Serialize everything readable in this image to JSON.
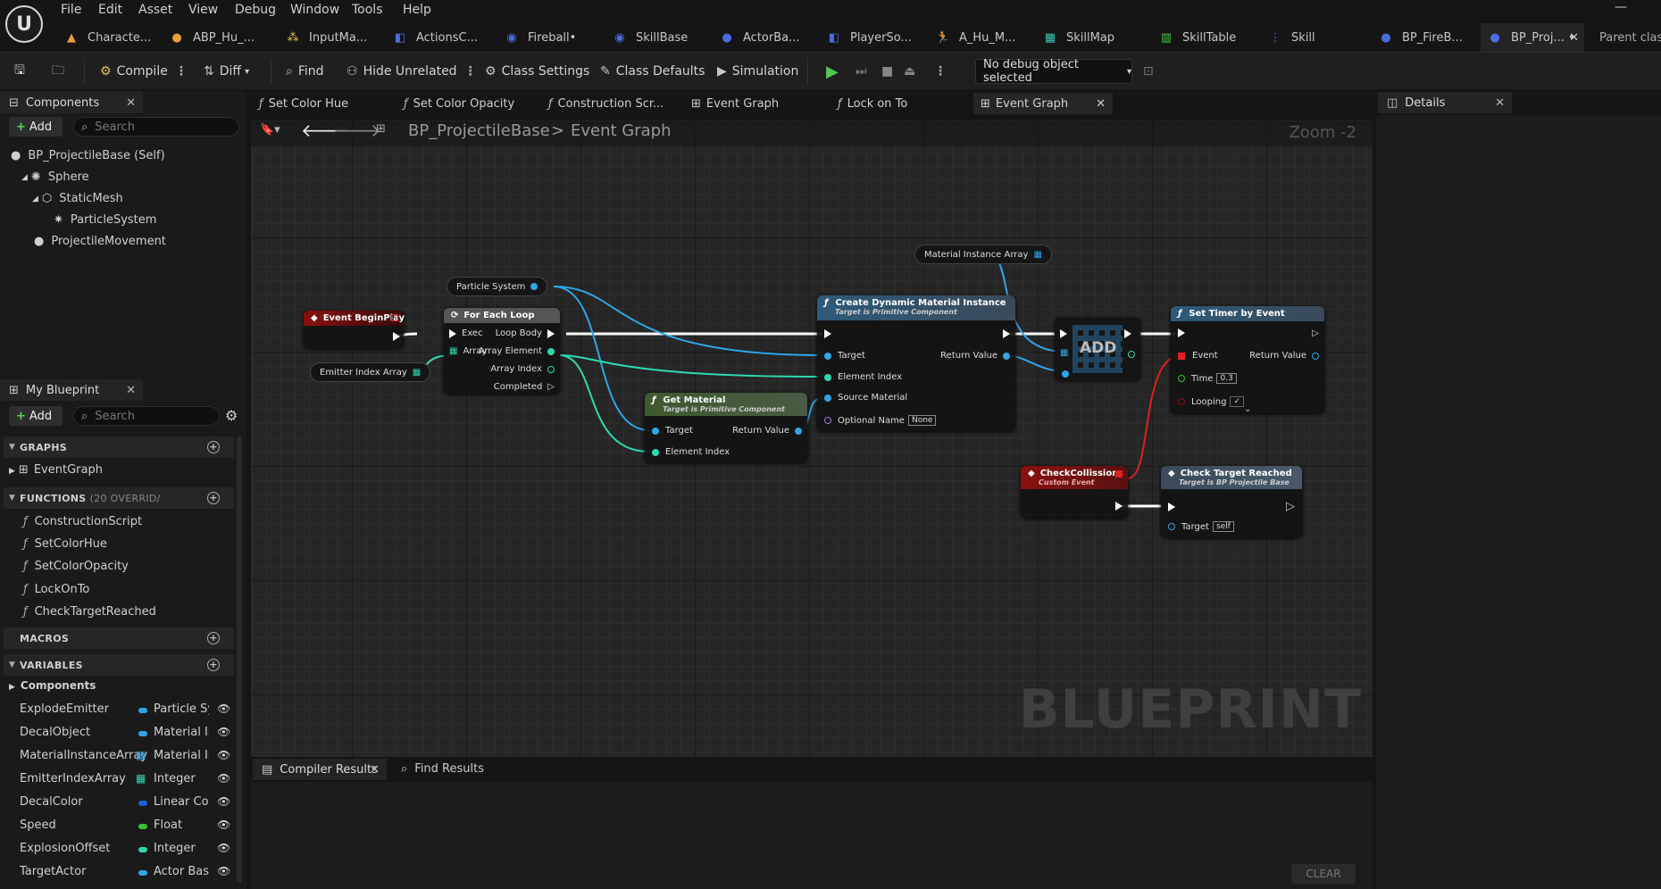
{
  "menu": [
    "File",
    "Edit",
    "Asset",
    "View",
    "Debug",
    "Window",
    "Tools",
    "Help"
  ],
  "asset_tabs": [
    {
      "label": "Characte...",
      "icon": "person-icon"
    },
    {
      "label": "ABP_Hu_...",
      "icon": "person-icon"
    },
    {
      "label": "InputMa...",
      "icon": "input-icon"
    },
    {
      "label": "ActionsC...",
      "icon": "blueprint-icon"
    },
    {
      "label": "Fireball•",
      "icon": "blueprint-icon"
    },
    {
      "label": "SkillBase",
      "icon": "blueprint-icon"
    },
    {
      "label": "ActorBa...",
      "icon": "person-icon"
    },
    {
      "label": "PlayerSo...",
      "icon": "blueprint-icon"
    },
    {
      "label": "A_Hu_M...",
      "icon": "animation-icon"
    },
    {
      "label": "SkillMap",
      "icon": "map-icon"
    },
    {
      "label": "SkillTable",
      "icon": "table-icon"
    },
    {
      "label": "Skill",
      "icon": "struct-icon"
    },
    {
      "label": "BP_FireB...",
      "icon": "person-icon"
    },
    {
      "label": "BP_Proj... •",
      "icon": "person-icon"
    }
  ],
  "parent_class": "Parent class",
  "toolbar": {
    "compile": "Compile",
    "diff": "Diff",
    "find": "Find",
    "hide_unrelated": "Hide Unrelated",
    "class_settings": "Class Settings",
    "class_defaults": "Class Defaults",
    "simulation": "Simulation",
    "debug_object": "No debug object selected"
  },
  "graph_tabs": [
    {
      "label": "Set Color Hue",
      "kind": "function"
    },
    {
      "label": "Set Color Opacity",
      "kind": "function"
    },
    {
      "label": "Construction Scr...",
      "kind": "function"
    },
    {
      "label": "Event Graph",
      "kind": "graph"
    },
    {
      "label": "Lock on To",
      "kind": "function"
    },
    {
      "label": "Event Graph",
      "kind": "graph"
    }
  ],
  "components_panel": {
    "title": "Components",
    "add": "Add",
    "search_placeholder": "Search",
    "items": [
      "BP_ProjectileBase (Self)",
      "Sphere",
      "StaticMesh",
      "ParticleSystem",
      "ProjectileMovement"
    ]
  },
  "my_blueprint": {
    "title": "My Blueprint",
    "add": "Add",
    "search_placeholder": "Search",
    "graphs_header": "GRAPHS",
    "graphs": [
      "EventGraph"
    ],
    "functions_header": "FUNCTIONS",
    "functions_overrides": "(20 OVERRID/",
    "functions": [
      "ConstructionScript",
      "SetColorHue",
      "SetColorOpacity",
      "LockOnTo",
      "CheckTargetReached"
    ],
    "macros_header": "MACROS",
    "variables_header": "VARIABLES",
    "components_group": "Components",
    "variables": [
      {
        "name": "ExplodeEmitter",
        "type": "Particle Sy",
        "color": "#2fa6e8",
        "kind": "single"
      },
      {
        "name": "DecalObject",
        "type": "Material In",
        "color": "#2fa6e8",
        "kind": "single"
      },
      {
        "name": "MaterialInstanceArray",
        "type": "Material In",
        "color": "#2fa6e8",
        "kind": "array"
      },
      {
        "name": "EmitterIndexArray",
        "type": "Integer",
        "color": "#2fd9b0",
        "kind": "array"
      },
      {
        "name": "DecalColor",
        "type": "Linear Colo",
        "color": "#1a5fd6",
        "kind": "single"
      },
      {
        "name": "Speed",
        "type": "Float",
        "color": "#35c435",
        "kind": "single"
      },
      {
        "name": "ExplosionOffset",
        "type": "Integer",
        "color": "#2fd9b0",
        "kind": "single"
      },
      {
        "name": "TargetActor",
        "type": "Actor Base",
        "color": "#2fa6e8",
        "kind": "single"
      }
    ]
  },
  "breadcrumb": {
    "root": "BP_ProjectileBase",
    "sep": ">",
    "leaf": "Event Graph"
  },
  "zoom": "Zoom -2",
  "watermark": "BLUEPRINT",
  "nodes": {
    "event_begin_play": {
      "title": "Event BeginPlay"
    },
    "emitter_index_array": {
      "label": "Emitter Index Array"
    },
    "particle_system": {
      "label": "Particle System"
    },
    "for_each": {
      "title": "For Each Loop",
      "exec": "Exec",
      "array": "Array",
      "loop_body": "Loop Body",
      "array_element": "Array Element",
      "array_index": "Array Index",
      "completed": "Completed"
    },
    "material_instance_array": {
      "label": "Material Instance Array"
    },
    "create_dmi": {
      "title": "Create Dynamic Material Instance",
      "subtitle": "Target is Primitive Component",
      "target": "Target",
      "element_index": "Element Index",
      "source_material": "Source Material",
      "optional_name": "Optional Name",
      "optional_name_value": "None",
      "return_value": "Return Value"
    },
    "get_material": {
      "title": "Get Material",
      "subtitle": "Target is Primitive Component",
      "target": "Target",
      "element_index": "Element Index",
      "return_value": "Return Value"
    },
    "add": {
      "label": "ADD"
    },
    "set_timer": {
      "title": "Set Timer by Event",
      "event": "Event",
      "time": "Time",
      "time_value": "0.3",
      "looping": "Looping",
      "return_value": "Return Value"
    },
    "check_collision": {
      "title": "CheckCollission",
      "subtitle": "Custom Event"
    },
    "check_target": {
      "title": "Check Target Reached",
      "subtitle": "Target is BP Projectile Base",
      "target": "Target",
      "target_value": "self"
    }
  },
  "details": {
    "title": "Details"
  },
  "bottom": {
    "compiler_results": "Compiler Results",
    "find_results": "Find Results",
    "clear": "CLEAR"
  }
}
